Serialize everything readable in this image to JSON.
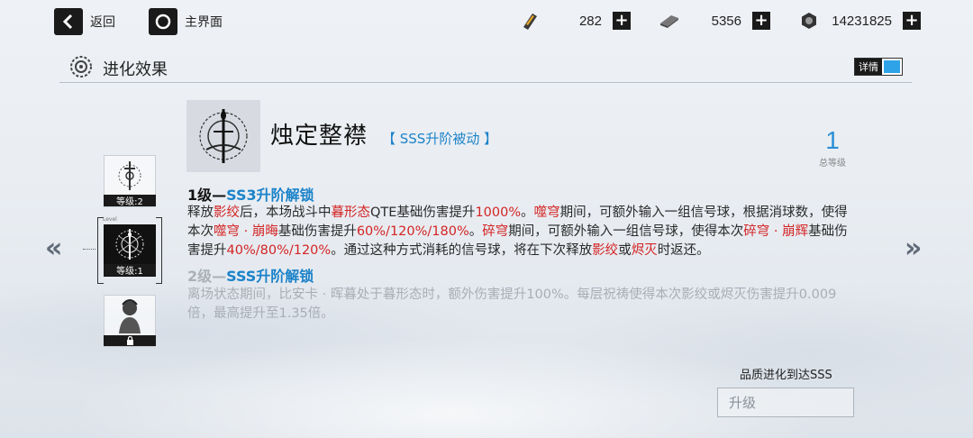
{
  "topbar": {
    "back_label": "返回",
    "home_label": "主界面",
    "resources": [
      {
        "icon": "ticket-icon",
        "value": "282"
      },
      {
        "icon": "material-bar-icon",
        "value": "5356"
      },
      {
        "icon": "coin-icon",
        "value": "14231825"
      }
    ],
    "plus_label": "+"
  },
  "section": {
    "title": "进化效果",
    "detail_toggle_label": "详情"
  },
  "levels": {
    "slot1_tag": "等级:2",
    "slot2_tag": "等级:1",
    "small_level_text": "Level"
  },
  "skill": {
    "name": "烛定整襟",
    "type": "【 SSS升阶被动 】",
    "total_level": "1",
    "total_level_caption": "总等级"
  },
  "tier1": {
    "prefix": "1级—",
    "unlock": "SS3升阶解锁",
    "description": [
      {
        "t": "释放",
        "c": ""
      },
      {
        "t": "影绞",
        "c": "red"
      },
      {
        "t": "后，本场战斗中",
        "c": ""
      },
      {
        "t": "暮形态",
        "c": "red"
      },
      {
        "t": "QTE基础伤害提升",
        "c": ""
      },
      {
        "t": "1000%",
        "c": "red"
      },
      {
        "t": "。",
        "c": ""
      },
      {
        "t": "噬穹",
        "c": "red"
      },
      {
        "t": "期间，可额外输入一组信号球，根据消球数，使得本次",
        "c": ""
      },
      {
        "t": "噬穹 · 崩晦",
        "c": "red"
      },
      {
        "t": "基础伤害提升",
        "c": ""
      },
      {
        "t": "60%/120%/180%",
        "c": "red"
      },
      {
        "t": "。",
        "c": ""
      },
      {
        "t": "碎穹",
        "c": "red"
      },
      {
        "t": "期间，可额外输入一组信号球，使得本次",
        "c": ""
      },
      {
        "t": "碎穹 · 崩辉",
        "c": "red"
      },
      {
        "t": "基础伤害提升",
        "c": ""
      },
      {
        "t": "40%/80%/120%",
        "c": "red"
      },
      {
        "t": "。通过这种方式消耗的信号球，将在下次释放",
        "c": ""
      },
      {
        "t": "影绞",
        "c": "red"
      },
      {
        "t": "或",
        "c": ""
      },
      {
        "t": "烬灭",
        "c": "red"
      },
      {
        "t": "时返还。",
        "c": ""
      }
    ]
  },
  "tier2": {
    "prefix": "2级—",
    "unlock": "SSS升阶解锁",
    "description": "离场状态期间，比安卡 · 晖暮处于暮形态时，额外伤害提升100%。每层祝祷使得本次影绞或烬灭伤害提升0.009倍，最高提升至1.35倍。"
  },
  "footer": {
    "quality_note": "品质进化到达SSS",
    "upgrade_label": "升级"
  },
  "colors": {
    "accent_blue": "#1c83c9",
    "highlight_red": "#d42424",
    "toggle_blue": "#2ea3e8"
  }
}
